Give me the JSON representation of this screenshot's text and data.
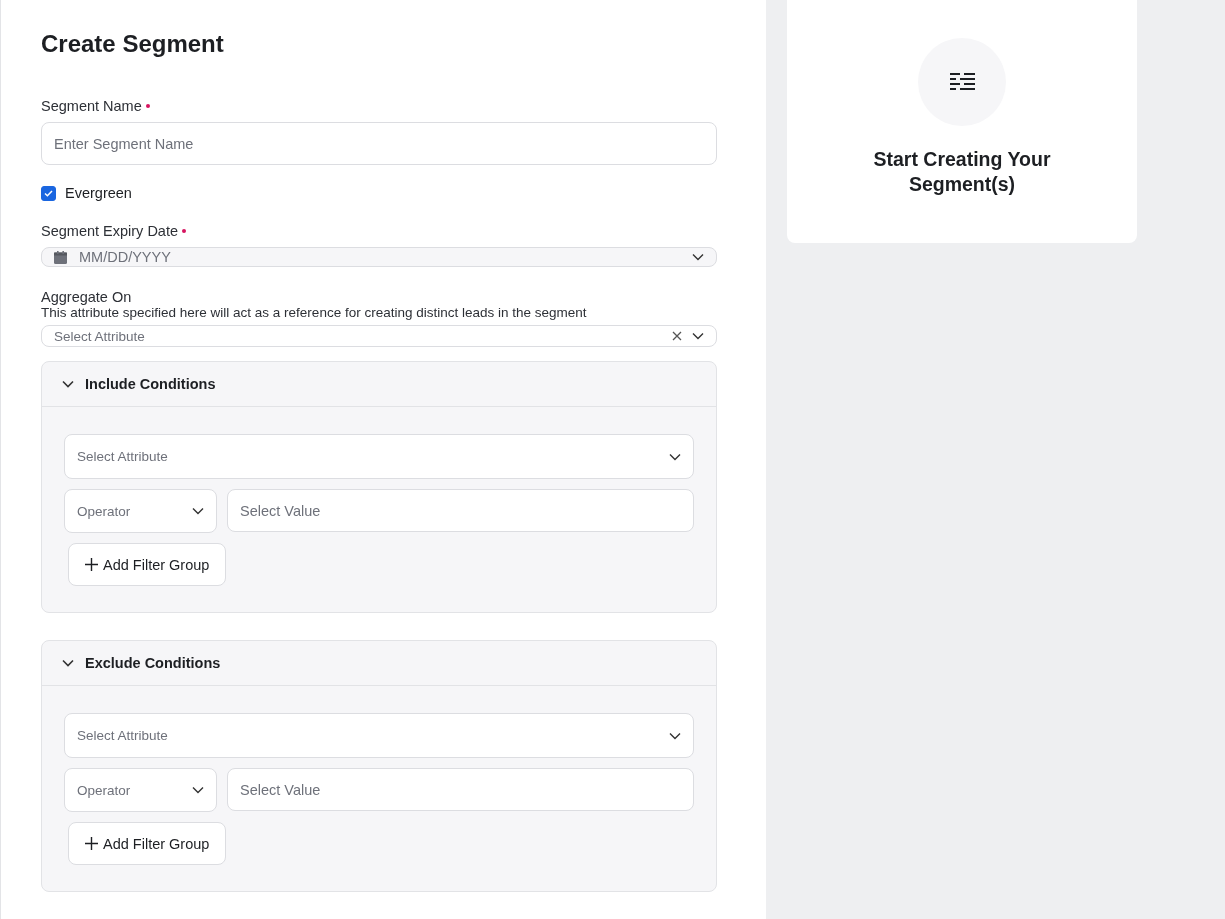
{
  "title": "Create Segment",
  "segment_name": {
    "label": "Segment Name",
    "required": true,
    "placeholder": "Enter Segment Name"
  },
  "evergreen": {
    "label": "Evergreen",
    "checked": true
  },
  "expiry_date": {
    "label": "Segment Expiry Date",
    "required": true,
    "placeholder": "MM/DD/YYYY"
  },
  "aggregate_on": {
    "label": "Aggregate On",
    "description": "This attribute specified here will act as a reference for creating distinct leads in the segment",
    "placeholder": "Select Attribute"
  },
  "condition_sections": [
    {
      "title": "Include Conditions",
      "expanded": true,
      "attribute_placeholder": "Select Attribute",
      "operator_placeholder": "Operator",
      "value_placeholder": "Select Value",
      "add_button": "Add Filter Group"
    },
    {
      "title": "Exclude Conditions",
      "expanded": true,
      "attribute_placeholder": "Select Attribute",
      "operator_placeholder": "Operator",
      "value_placeholder": "Select Value",
      "add_button": "Add Filter Group"
    }
  ],
  "empty_state": {
    "title": "Start Creating Your Segment(s)"
  }
}
